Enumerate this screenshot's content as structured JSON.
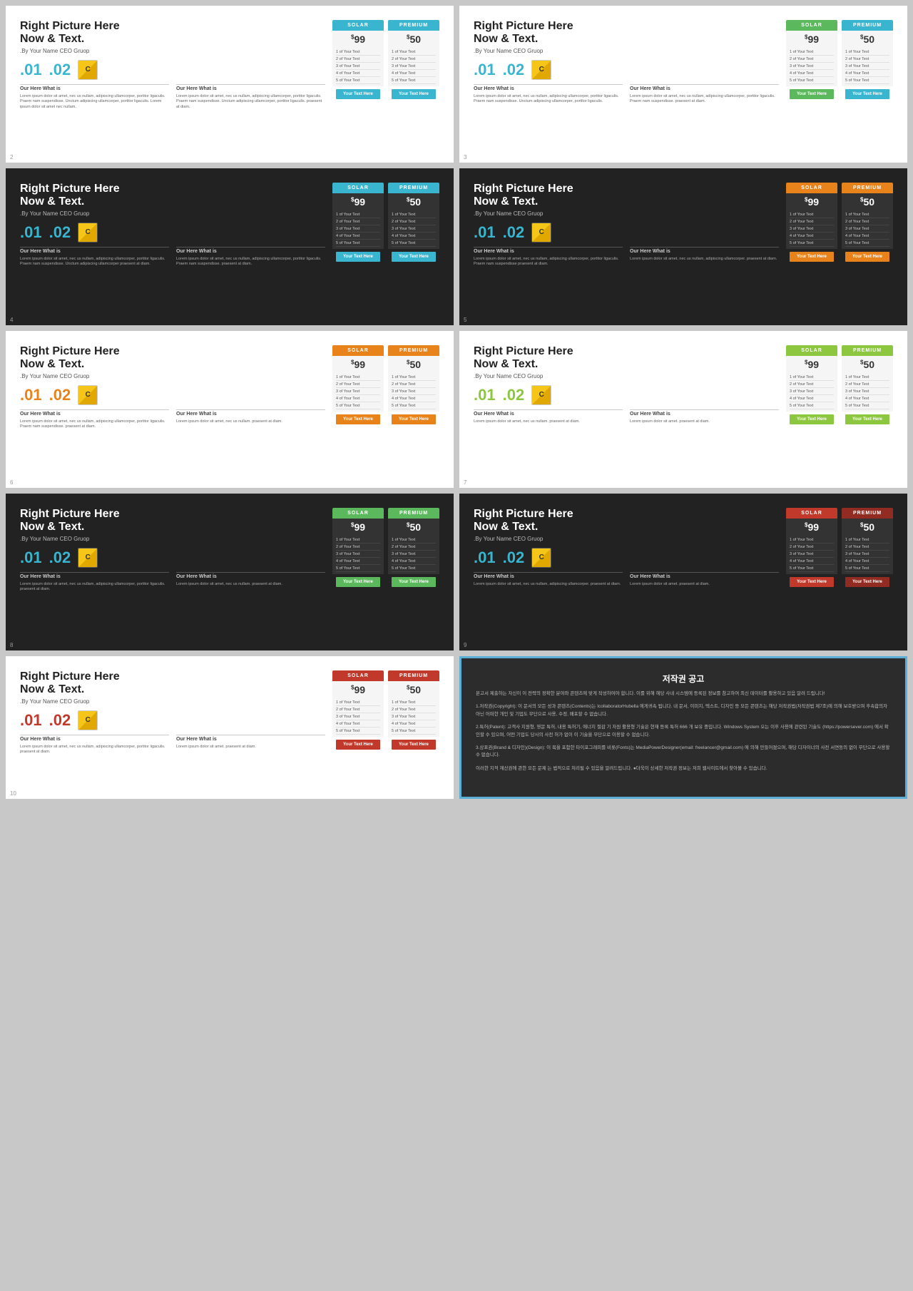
{
  "slides": [
    {
      "id": 2,
      "dark": false,
      "title1": "Right Picture Here",
      "title2": "Now & Text.",
      "subtitle": ".By Your Name CEO Gruop",
      "stat1": ".01",
      "stat2": ".02",
      "label1": "Our Here What is",
      "label2": "Our Here What is",
      "desc": "Lorem ipsum dolor sit amet, nec us nullam, adipiscing ullamcorper, portitor ligaculis. Praem nam suspendisse. Unctum adipiscing ullamcorper, portitor ligaculis. Lorem ipsum dolor sit amet, nec nullam, adipiscing ullamcorper, portitor ligaculis. Praem nam suspendisse. Unctum adipiscing ullamcorper, portitor ligaculis. agen ante unctum, eros in auctor fringilla praesent at diam.",
      "card1": {
        "header": "SOLAR",
        "color": "cyan",
        "price": "99",
        "btn": "Your Text Here"
      },
      "card2": {
        "header": "PREMIUM",
        "color": "cyan",
        "price": "50",
        "btn": "Your Text Here"
      }
    },
    {
      "id": 3,
      "dark": false,
      "title1": "Right Picture Here",
      "title2": "Now & Text.",
      "subtitle": ".By Your Name CEO Gruop",
      "stat1": ".01",
      "stat2": ".02",
      "label1": "Our Here What is",
      "label2": "Our Here What is",
      "desc": "Lorem ipsum dolor sit amet, nec us nullam...",
      "card1": {
        "header": "SOLAR",
        "color": "green",
        "price": "99",
        "btn": "Your Text Here"
      },
      "card2": {
        "header": "PREMIUM",
        "color": "cyan",
        "price": "50",
        "btn": "Your Text Here"
      }
    },
    {
      "id": 4,
      "dark": true,
      "title1": "Right Picture Here",
      "title2": "Now & Text.",
      "subtitle": ".By Your Name CEO Gruop",
      "stat1": ".01",
      "stat2": ".02",
      "label1": "Our Here What is",
      "label2": "Our Here What is",
      "desc": "Lorem ipsum dolor sit amet...",
      "card1": {
        "header": "SOLAR",
        "color": "cyan",
        "price": "99",
        "btn": "Your Text Here"
      },
      "card2": {
        "header": "PREMIUM",
        "color": "cyan",
        "price": "50",
        "btn": "Your Text Here"
      }
    },
    {
      "id": 5,
      "dark": true,
      "title1": "Right Picture Here",
      "title2": "Now & Text.",
      "subtitle": ".By Your Name CEO Gruop",
      "stat1": ".01",
      "stat2": ".02",
      "label1": "Our Here What is",
      "label2": "Our Here What is",
      "desc": "Lorem ipsum dolor sit amet...",
      "card1": {
        "header": "SOLAR",
        "color": "orange",
        "price": "99",
        "btn": "Your Text Here"
      },
      "card2": {
        "header": "PREMIUM",
        "color": "orange",
        "price": "50",
        "btn": "Your Text Here"
      }
    },
    {
      "id": 6,
      "dark": false,
      "title1": "Right Picture Here",
      "title2": "Now & Text.",
      "subtitle": ".By Your Name CEO Gruop",
      "stat1": ".01",
      "stat2": ".02",
      "label1": "Our Here What is",
      "label2": "Our Here What is",
      "desc": "Lorem ipsum dolor sit amet...",
      "card1": {
        "header": "SOLAR",
        "color": "orange",
        "price": "99",
        "btn": "Your Text Here"
      },
      "card2": {
        "header": "PREMIUM",
        "color": "orange",
        "price": "50",
        "btn": "Your Text Here"
      }
    },
    {
      "id": 7,
      "dark": false,
      "title1": "Right Picture Here",
      "title2": "Now & Text.",
      "subtitle": ".By Your Name CEO Gruop",
      "stat1": ".01",
      "stat2": ".02",
      "label1": "Our Here What is",
      "label2": "Our Here What is",
      "desc": "Lorem ipsum dolor sit amet...",
      "card1": {
        "header": "SOLAR",
        "color": "green2",
        "price": "99",
        "btn": "Your Text Here"
      },
      "card2": {
        "header": "PREMIUM",
        "color": "green2",
        "price": "50",
        "btn": "Your Text Here"
      }
    },
    {
      "id": 8,
      "dark": true,
      "title1": "Right Picture Here",
      "title2": "Now & Text.",
      "subtitle": ".By Your Name CEO Gruop",
      "stat1": ".01",
      "stat2": ".02",
      "label1": "Our Here What is",
      "label2": "Our Here What is",
      "desc": "Lorem ipsum dolor sit amet...",
      "card1": {
        "header": "SOLAR",
        "color": "green",
        "price": "99",
        "btn": "Your Text Here"
      },
      "card2": {
        "header": "PREMIUM",
        "color": "green",
        "price": "50",
        "btn": "Your Text Here"
      }
    },
    {
      "id": 9,
      "dark": true,
      "title1": "Right Picture Here",
      "title2": "Now & Text.",
      "subtitle": ".By Your Name CEO Gruop",
      "stat1": ".01",
      "stat2": ".02",
      "label1": "Our Here What is",
      "label2": "Our Here What is",
      "desc": "Lorem ipsum dolor sit amet...",
      "card1": {
        "header": "SOLAR",
        "color": "red",
        "price": "99",
        "btn": "Your Text Here"
      },
      "card2": {
        "header": "PREMIUM",
        "color": "darkred",
        "price": "50",
        "btn": "Your Text Here"
      }
    },
    {
      "id": 10,
      "dark": false,
      "title1": "Right Picture Here",
      "title2": "Now & Text.",
      "subtitle": ".By Your Name CEO Gruop",
      "stat1": ".01",
      "stat2": ".02",
      "label1": "Our Here What is",
      "label2": "Our Here What is",
      "desc": "Lorem ipsum dolor sit amet...",
      "card1": {
        "header": "SOLAR",
        "color": "red",
        "price": "99",
        "btn": "Your Text Here"
      },
      "card2": {
        "header": "PREMIUM",
        "color": "red",
        "price": "50",
        "btn": "Your Text Here"
      }
    }
  ],
  "features": [
    "1 of Your Text",
    "2 of Your Text",
    "3 of Your Text",
    "4 of Your Text",
    "5 of Your Text"
  ],
  "copyright": {
    "title": "저작권 공고",
    "para1": "본고서 제출하는 자신이 이 전략의 정확한 분야와 콘텐츠에 맞게 작성하여야 합니다. 이를 위해 해당 사내 시스템에 등록된 정보를 참고하여 최신 데이터를 활용하고 있음 알려 드립니다!",
    "para2": "1.저작권(Copyright): 이 문서의 모든 성과 콘텐츠(Contents)는 IcollaboratorHubella 에게귀속 됩니다. 내 문서, 이미지, 텍스트, 디자인 등 모든 콘텐츠는 해당 저작권법(저작권법 제7조)에 의해 보호받으며 후속합의자 아닌 어떠한 개인 및 기업도 무단으로 사용, 수정, 배포할 수 없습니다.",
    "para3": "2.특허(Patent): 고객사 지원형, 영문 특허, 내용 특허기, 에너지 절감 기 자원 활용형 기술은 현재 등록 특허 666 개 보유 중입니다. Windows System 오는 이후 사용에 관련된 기술도 (https://powersever.com) 에서 확인할 수 있으며, 어떤 기업도 당사의 사전 허가 없이 이 기술을 무단으로 이용할 수 없습니다.",
    "para4": "3.상표권(Brand & 디자인)(Design): 이 목을 포함한 타이포그래피를 비롯(Fonts)는 MediaPowerDesigner(email: freelancer@gmail.com) 에 의해 만들어졌으며, 해당 디자이너의 사전 서면동의 없이 무단으로 사용할 수 없습니다.",
    "para5": "이러한 지적 재산권에 관한 모든 문제 는 법적으로 처리될 수 있음을 알려드립니다. ●더욱이 상세한 저작권 정보는 저희 웹사이트에서 찾아볼 수 있습니다."
  },
  "colors": {
    "cyan": "#3ab5d0",
    "orange": "#e8821a",
    "green": "#5cb85c",
    "green2": "#8dc63f",
    "red": "#c0392b",
    "darkred": "#922b21"
  }
}
